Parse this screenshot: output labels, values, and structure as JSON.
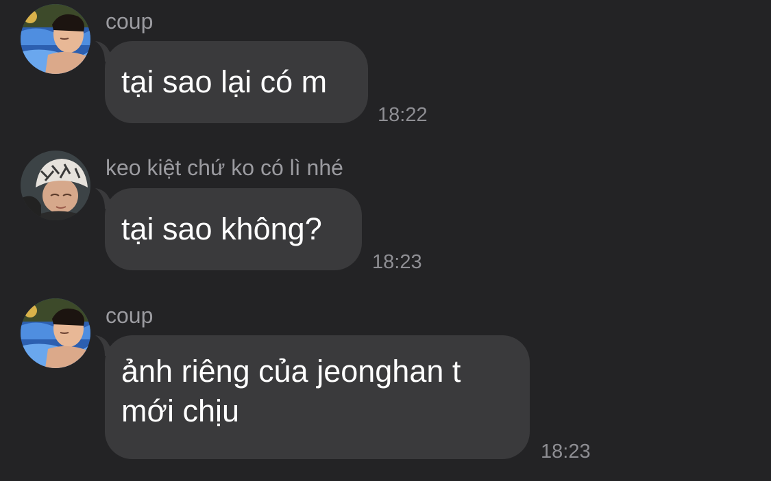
{
  "messages": [
    {
      "sender": "coup",
      "avatar": "coup-avatar",
      "text": "tại sao lại có m",
      "time": "18:22"
    },
    {
      "sender": "keo kiệt chứ ko có lì nhé",
      "avatar": "keo-kiet-avatar",
      "text": "tại sao không?",
      "time": "18:23"
    },
    {
      "sender": "coup",
      "avatar": "coup-avatar",
      "text": "ảnh riêng của jeonghan t\nmới chịu",
      "time": "18:23"
    }
  ],
  "colors": {
    "background": "#232325",
    "bubble": "#3a3a3c",
    "message_text": "#ffffff",
    "sender_text": "#9b9ba0",
    "time_text": "#8e8e93"
  }
}
